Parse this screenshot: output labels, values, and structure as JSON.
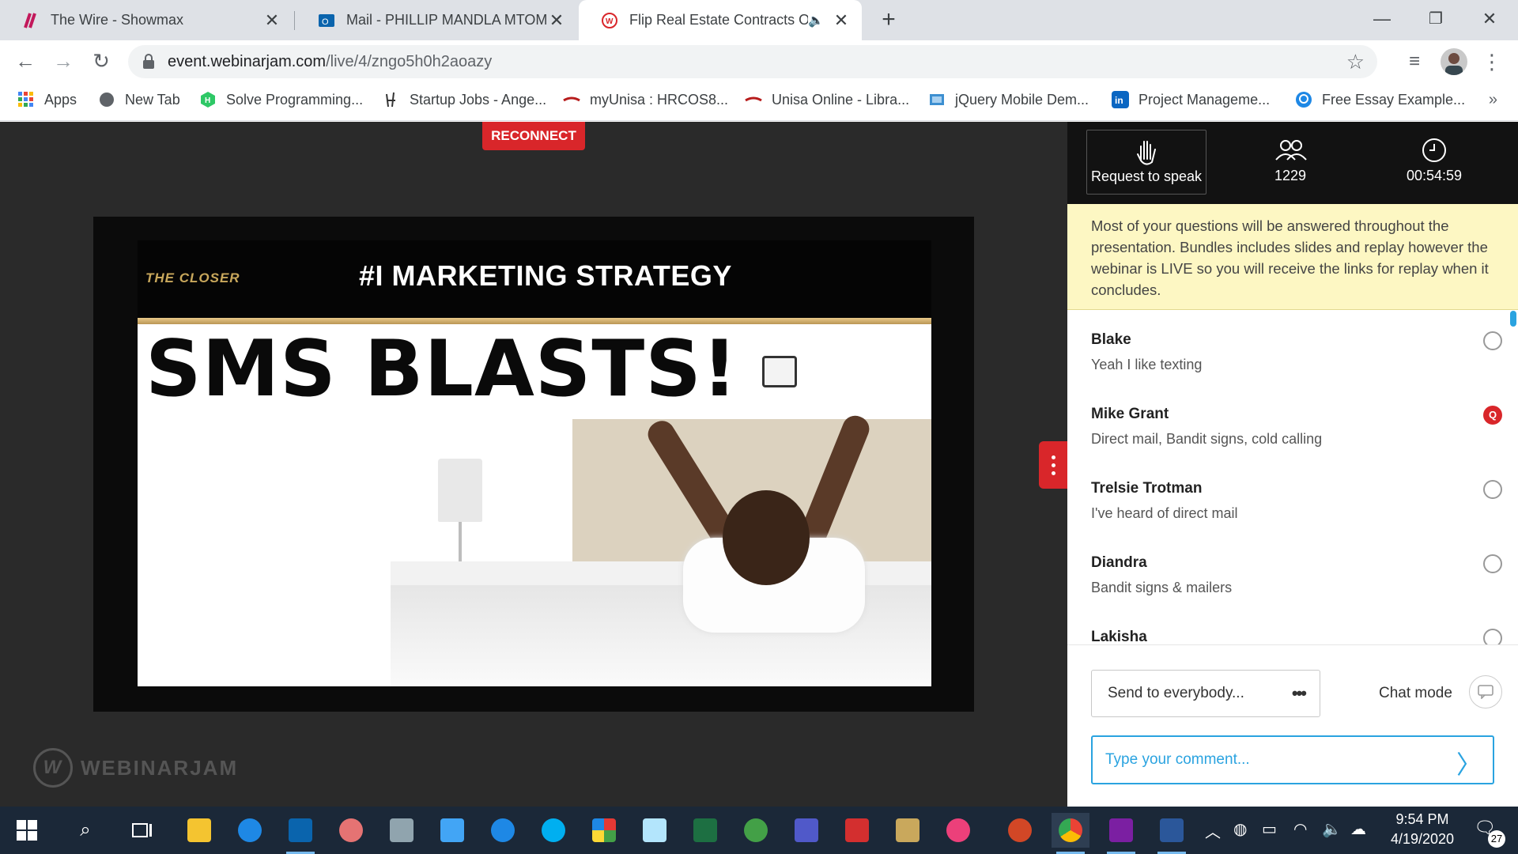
{
  "browser": {
    "tabs": [
      {
        "title": "The Wire - Showmax",
        "icon": "showmax-icon",
        "color": "#c2185b"
      },
      {
        "title": "Mail - PHILLIP MANDLA MTOMBENI - Outlook",
        "icon": "outlook-icon",
        "color": "#0a64ad"
      },
      {
        "title": "Flip Real Estate Contracts Of",
        "icon": "webinarjam-icon",
        "color": "#d9262a"
      }
    ],
    "url_host": "event.webinarjam.com",
    "url_path": "/live/4/zngo5h0h2aoazy"
  },
  "bookmarks": [
    {
      "label": "Apps",
      "color": "#4285f4"
    },
    {
      "label": "New Tab",
      "color": "#5f6368"
    },
    {
      "label": "Solve Programming...",
      "color": "#2ec866"
    },
    {
      "label": "Startup Jobs - Ange...",
      "color": "#333333"
    },
    {
      "label": "myUnisa : HRCOS8...",
      "color": "#b71c1c"
    },
    {
      "label": "Unisa Online - Libra...",
      "color": "#b71c1c"
    },
    {
      "label": "jQuery Mobile Dem...",
      "color": "#3d8fd1"
    },
    {
      "label": "Project Manageme...",
      "color": "#0a66c2"
    },
    {
      "label": "Free Essay Example...",
      "color": "#1e88e5"
    }
  ],
  "stage": {
    "reconnect_label": "RECONNECT",
    "slide_logo": "THE CLOSER",
    "slide_title": "#I MARKETING STRATEGY",
    "slide_headline": "SMS BLASTS!",
    "watermark": "WEBINARJAM"
  },
  "panel": {
    "request_label": "Request to speak",
    "attendee_count": "1229",
    "timer": "00:54:59",
    "notice": "Most of your questions will be answered throughout the presentation. Bundles includes slides and replay however the webinar is LIVE so you will receive the links for replay when it concludes.",
    "messages": [
      {
        "name": "Blake",
        "text": "Yeah I like texting",
        "flag": ""
      },
      {
        "name": "Mike Grant",
        "text": "Direct mail, Bandit signs, cold calling",
        "flag": "Q"
      },
      {
        "name": "Trelsie Trotman",
        "text": "I've heard of direct mail",
        "flag": ""
      },
      {
        "name": "Diandra",
        "text": "Bandit signs & mailers",
        "flag": ""
      },
      {
        "name": "Lakisha",
        "text": "",
        "flag": ""
      }
    ],
    "send_to": "Send to everybody...",
    "chat_mode_label": "Chat mode",
    "comment_placeholder": "Type your comment..."
  },
  "taskbar": {
    "time": "9:54 PM",
    "date": "4/19/2020",
    "notification_count": "27"
  },
  "colors": {
    "accent_red": "#d9262a",
    "accent_blue": "#2aa3e0",
    "notice_bg": "#fdf7c3"
  }
}
